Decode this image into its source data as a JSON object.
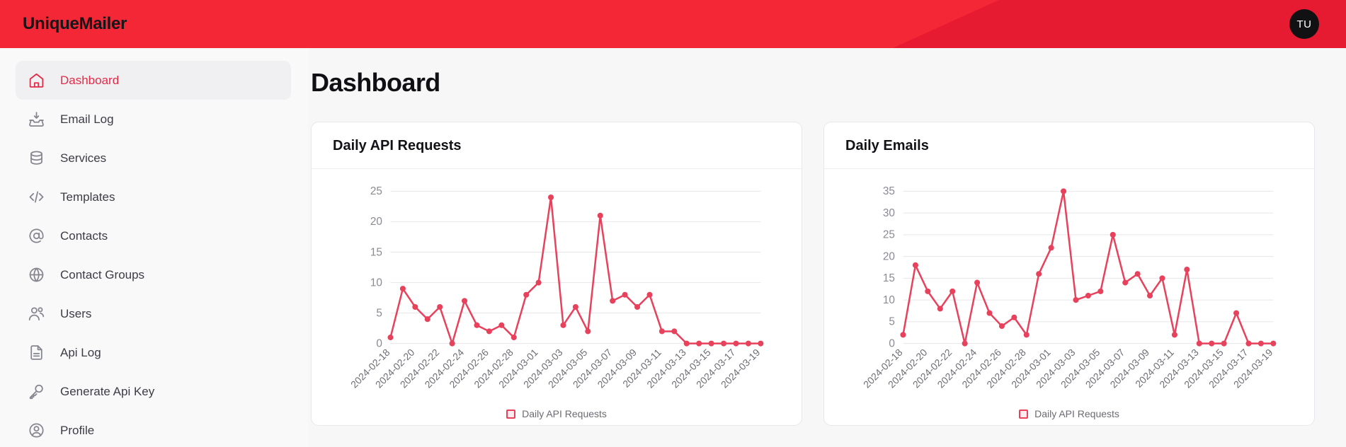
{
  "header": {
    "brand": "UniqueMailer",
    "avatar_initials": "TU",
    "bg_color": "#f32735",
    "avatar_bg": "#111114"
  },
  "sidebar": {
    "items": [
      {
        "label": "Dashboard",
        "icon": "home-icon",
        "active": true
      },
      {
        "label": "Email Log",
        "icon": "inbox-icon",
        "active": false
      },
      {
        "label": "Services",
        "icon": "database-icon",
        "active": false
      },
      {
        "label": "Templates",
        "icon": "code-icon",
        "active": false
      },
      {
        "label": "Contacts",
        "icon": "at-sign-icon",
        "active": false
      },
      {
        "label": "Contact Groups",
        "icon": "globe-icon",
        "active": false
      },
      {
        "label": "Users",
        "icon": "users-icon",
        "active": false
      },
      {
        "label": "Api Log",
        "icon": "file-text-icon",
        "active": false
      },
      {
        "label": "Generate Api Key",
        "icon": "key-icon",
        "active": false
      },
      {
        "label": "Profile",
        "icon": "user-circle-icon",
        "active": false
      }
    ]
  },
  "main": {
    "page_title": "Dashboard",
    "accent_color": "#e8415c"
  },
  "chart_data": [
    {
      "type": "line",
      "title": "Daily API Requests",
      "xlabel": "",
      "ylabel": "",
      "ylim": [
        0,
        25
      ],
      "yticks": [
        0,
        5,
        10,
        15,
        20,
        25
      ],
      "grid": true,
      "legend_position": "bottom",
      "legend": [
        "Daily API Requests"
      ],
      "line_color": "#e8415c",
      "categories": [
        "2024-02-18",
        "2024-02-19",
        "2024-02-20",
        "2024-02-21",
        "2024-02-22",
        "2024-02-23",
        "2024-02-24",
        "2024-02-25",
        "2024-02-26",
        "2024-02-27",
        "2024-02-28",
        "2024-02-29",
        "2024-03-01",
        "2024-03-02",
        "2024-03-03",
        "2024-03-04",
        "2024-03-05",
        "2024-03-06",
        "2024-03-07",
        "2024-03-08",
        "2024-03-09",
        "2024-03-10",
        "2024-03-11",
        "2024-03-12",
        "2024-03-13",
        "2024-03-14",
        "2024-03-15",
        "2024-03-16",
        "2024-03-17",
        "2024-03-18",
        "2024-03-19"
      ],
      "tick_labels": [
        "2024-02-18",
        "2024-02-20",
        "2024-02-22",
        "2024-02-24",
        "2024-02-26",
        "2024-02-28",
        "2024-03-01",
        "2024-03-03",
        "2024-03-05",
        "2024-03-07",
        "2024-03-09",
        "2024-03-11",
        "2024-03-13",
        "2024-03-15",
        "2024-03-17",
        "2024-03-19"
      ],
      "values": [
        1,
        9,
        6,
        4,
        6,
        0,
        7,
        3,
        2,
        3,
        1,
        8,
        10,
        24,
        3,
        6,
        2,
        21,
        7,
        8,
        6,
        8,
        2,
        2,
        0,
        0,
        0,
        0,
        0,
        0,
        0
      ]
    },
    {
      "type": "line",
      "title": "Daily Emails",
      "xlabel": "",
      "ylabel": "",
      "ylim": [
        0,
        35
      ],
      "yticks": [
        0,
        5,
        10,
        15,
        20,
        25,
        30,
        35
      ],
      "grid": true,
      "legend_position": "bottom",
      "legend": [
        "Daily API Requests"
      ],
      "line_color": "#e8415c",
      "categories": [
        "2024-02-18",
        "2024-02-19",
        "2024-02-20",
        "2024-02-21",
        "2024-02-22",
        "2024-02-23",
        "2024-02-24",
        "2024-02-25",
        "2024-02-26",
        "2024-02-27",
        "2024-02-28",
        "2024-02-29",
        "2024-03-01",
        "2024-03-02",
        "2024-03-03",
        "2024-03-04",
        "2024-03-05",
        "2024-03-06",
        "2024-03-07",
        "2024-03-08",
        "2024-03-09",
        "2024-03-10",
        "2024-03-11",
        "2024-03-12",
        "2024-03-13",
        "2024-03-14",
        "2024-03-15",
        "2024-03-16",
        "2024-03-17",
        "2024-03-18",
        "2024-03-19"
      ],
      "tick_labels": [
        "2024-02-18",
        "2024-02-20",
        "2024-02-22",
        "2024-02-24",
        "2024-02-26",
        "2024-02-28",
        "2024-03-01",
        "2024-03-03",
        "2024-03-05",
        "2024-03-07",
        "2024-03-09",
        "2024-03-11",
        "2024-03-13",
        "2024-03-15",
        "2024-03-17",
        "2024-03-19"
      ],
      "values": [
        2,
        18,
        12,
        8,
        12,
        0,
        14,
        7,
        4,
        6,
        2,
        16,
        22,
        35,
        10,
        11,
        12,
        25,
        14,
        16,
        11,
        15,
        2,
        17,
        0,
        0,
        0,
        7,
        0,
        0,
        0
      ]
    }
  ]
}
